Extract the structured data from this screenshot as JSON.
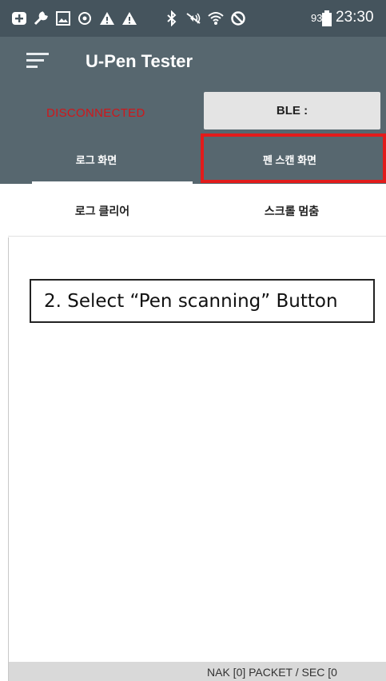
{
  "status_bar": {
    "icons": [
      "plus-square-icon",
      "wrench-icon",
      "image-icon",
      "sync-icon",
      "warning-icon",
      "warning-icon",
      "bluetooth-icon",
      "mute-icon",
      "wifi-icon",
      "blocked-icon",
      "battery-icon"
    ],
    "battery": "93%",
    "time": "23:30"
  },
  "toolbar": {
    "menu_icon": "menu-icon",
    "title": "U-Pen Tester"
  },
  "connection": {
    "status": "DISCONNECTED",
    "status_color": "#d0161a",
    "ble_label": "BLE :"
  },
  "tabs": {
    "log_screen": "로그 화면",
    "pen_scan_screen": "펜 스캔 화면"
  },
  "actions": {
    "clear_log": "로그 클리어",
    "stop_scroll": "스크롤 멈춤"
  },
  "callout": {
    "text": "2. Select “Pen scanning” Button",
    "highlight_color": "#e21b1b"
  },
  "footer": {
    "text": "NAK [0]  PACKET / SEC [0"
  },
  "colors": {
    "status_bar_bg": "#45545d",
    "toolbar_bg": "#57676f"
  }
}
